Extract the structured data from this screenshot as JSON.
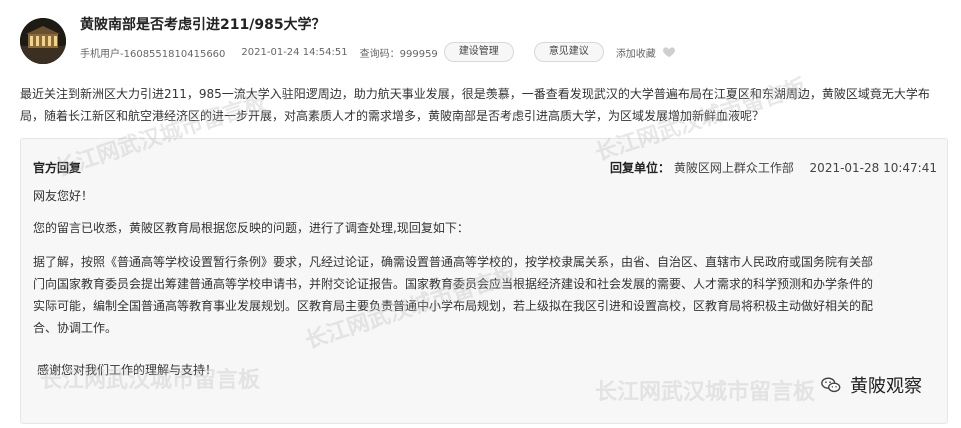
{
  "post": {
    "title": "黄陂南部是否考虑引进211/985大学？",
    "user": "手机用户-1608551810415660",
    "datetime": "2021-01-24 14:54:51",
    "query_code": "查询码：999959",
    "tag_label": "建设管理",
    "tag2_label": "意见建议",
    "favorite_label": "添加收藏",
    "question": "最近关注到新洲区大力引进211，985一流大学入驻阳逻周边，助力航天事业发展，很是羡慕，一番查看发现武汉的大学普遍布局在江夏区和东湖周边，黄陂区域竟无大学布局，随着长江新区和航空港经济区的进一步开展，对高素质人才的需求增多，黄陂南部是否考虑引进高质大学，为区域发展增加新鲜血液呢？"
  },
  "reply": {
    "label": "官方回复",
    "unit_label": "回复单位：",
    "unit": "黄陂区网上群众工作部",
    "datetime": "2021-01-28 10:47:41",
    "greeting": "网友您好！",
    "p1": "您的留言已收悉，黄陂区教育局根据您反映的问题，进行了调查处理,现回复如下：",
    "p2_line1": "据了解，按照《普通高等学校设置暂行条例》要求，凡经过论证，确需设置普通高等学校的，按学校隶属关系，由省、自治区、直辖市人民政府或国务院有关部",
    "p2_line2": "门向国家教育委员会提出筹建普通高等学校申请书，并附交论证报告。国家教育委员会应当根据经济建设和社会发展的需要、人才需求的科学预测和办学条件的",
    "p2_line3": "实际可能，编制全国普通高等教育事业发展规划。区教育局主要负责普通中小学布局规划，若上级拟在我区引进和设置高校，区教育局将积极主动做好相关的配",
    "p2_line4": "合、协调工作。",
    "thanks": "感谢您对我们工作的理解与支持！"
  },
  "watermark": "长江网武汉城市留言板",
  "brand": "黄陂观察",
  "colors": {
    "accent": "#222222",
    "reply_bg": "#f7f7f7"
  }
}
